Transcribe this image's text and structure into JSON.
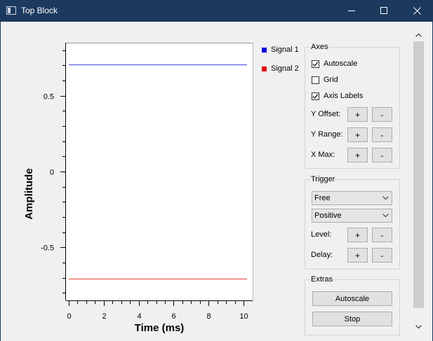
{
  "window": {
    "title": "Top Block"
  },
  "legend": [
    {
      "label": "Signal 1",
      "color": "#0000e0"
    },
    {
      "label": "Signal 2",
      "color": "#e00000"
    }
  ],
  "axes_group": {
    "title": "Axes",
    "autoscale_label": "Autoscale",
    "autoscale_checked": true,
    "grid_label": "Grid",
    "grid_checked": false,
    "axis_labels_label": "Axis Labels",
    "axis_labels_checked": true,
    "y_offset_label": "Y Offset:",
    "y_range_label": "Y Range:",
    "x_max_label": "X Max:",
    "plus": "+",
    "minus": "-"
  },
  "trigger_group": {
    "title": "Trigger",
    "mode_value": "Free",
    "slope_value": "Positive",
    "level_label": "Level:",
    "delay_label": "Delay:",
    "plus": "+",
    "minus": "-"
  },
  "extras_group": {
    "title": "Extras",
    "autoscale_button": "Autoscale",
    "stop_button": "Stop"
  },
  "chart_data": {
    "type": "line",
    "xlabel": "Time (ms)",
    "ylabel": "Amplitude",
    "xlim": [
      0,
      10.2
    ],
    "ylim": [
      -0.85,
      0.85
    ],
    "x_ticks": [
      0,
      2,
      4,
      6,
      8,
      10
    ],
    "x_tick_labels": [
      "0",
      "2",
      "4",
      "6",
      "8",
      "10"
    ],
    "y_ticks": [
      0.5,
      0,
      -0.5
    ],
    "y_tick_labels": [
      "0.5",
      "0",
      "-0.5"
    ],
    "grid": false,
    "legend_position": "right",
    "series": [
      {
        "name": "Signal 1",
        "color": "#7070e8",
        "x": [
          0,
          10.2
        ],
        "y": [
          0.707,
          0.707
        ]
      },
      {
        "name": "Signal 2",
        "color": "#f07070",
        "x": [
          0,
          10.2
        ],
        "y": [
          -0.707,
          -0.707
        ]
      }
    ]
  }
}
